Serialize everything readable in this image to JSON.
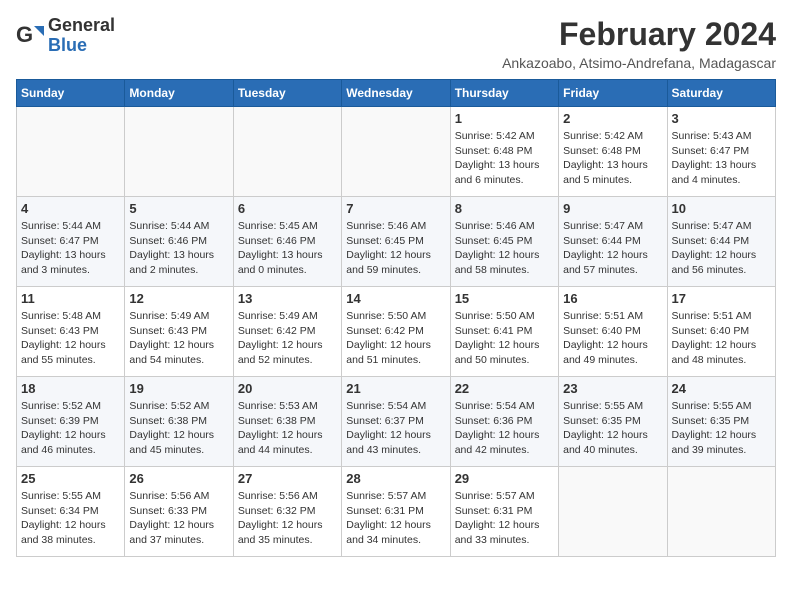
{
  "logo": {
    "general": "General",
    "blue": "Blue"
  },
  "title": {
    "month_year": "February 2024",
    "location": "Ankazoabo, Atsimo-Andrefana, Madagascar"
  },
  "weekdays": [
    "Sunday",
    "Monday",
    "Tuesday",
    "Wednesday",
    "Thursday",
    "Friday",
    "Saturday"
  ],
  "weeks": [
    [
      {
        "day": "",
        "info": ""
      },
      {
        "day": "",
        "info": ""
      },
      {
        "day": "",
        "info": ""
      },
      {
        "day": "",
        "info": ""
      },
      {
        "day": "1",
        "info": "Sunrise: 5:42 AM\nSunset: 6:48 PM\nDaylight: 13 hours and 6 minutes."
      },
      {
        "day": "2",
        "info": "Sunrise: 5:42 AM\nSunset: 6:48 PM\nDaylight: 13 hours and 5 minutes."
      },
      {
        "day": "3",
        "info": "Sunrise: 5:43 AM\nSunset: 6:47 PM\nDaylight: 13 hours and 4 minutes."
      }
    ],
    [
      {
        "day": "4",
        "info": "Sunrise: 5:44 AM\nSunset: 6:47 PM\nDaylight: 13 hours and 3 minutes."
      },
      {
        "day": "5",
        "info": "Sunrise: 5:44 AM\nSunset: 6:46 PM\nDaylight: 13 hours and 2 minutes."
      },
      {
        "day": "6",
        "info": "Sunrise: 5:45 AM\nSunset: 6:46 PM\nDaylight: 13 hours and 0 minutes."
      },
      {
        "day": "7",
        "info": "Sunrise: 5:46 AM\nSunset: 6:45 PM\nDaylight: 12 hours and 59 minutes."
      },
      {
        "day": "8",
        "info": "Sunrise: 5:46 AM\nSunset: 6:45 PM\nDaylight: 12 hours and 58 minutes."
      },
      {
        "day": "9",
        "info": "Sunrise: 5:47 AM\nSunset: 6:44 PM\nDaylight: 12 hours and 57 minutes."
      },
      {
        "day": "10",
        "info": "Sunrise: 5:47 AM\nSunset: 6:44 PM\nDaylight: 12 hours and 56 minutes."
      }
    ],
    [
      {
        "day": "11",
        "info": "Sunrise: 5:48 AM\nSunset: 6:43 PM\nDaylight: 12 hours and 55 minutes."
      },
      {
        "day": "12",
        "info": "Sunrise: 5:49 AM\nSunset: 6:43 PM\nDaylight: 12 hours and 54 minutes."
      },
      {
        "day": "13",
        "info": "Sunrise: 5:49 AM\nSunset: 6:42 PM\nDaylight: 12 hours and 52 minutes."
      },
      {
        "day": "14",
        "info": "Sunrise: 5:50 AM\nSunset: 6:42 PM\nDaylight: 12 hours and 51 minutes."
      },
      {
        "day": "15",
        "info": "Sunrise: 5:50 AM\nSunset: 6:41 PM\nDaylight: 12 hours and 50 minutes."
      },
      {
        "day": "16",
        "info": "Sunrise: 5:51 AM\nSunset: 6:40 PM\nDaylight: 12 hours and 49 minutes."
      },
      {
        "day": "17",
        "info": "Sunrise: 5:51 AM\nSunset: 6:40 PM\nDaylight: 12 hours and 48 minutes."
      }
    ],
    [
      {
        "day": "18",
        "info": "Sunrise: 5:52 AM\nSunset: 6:39 PM\nDaylight: 12 hours and 46 minutes."
      },
      {
        "day": "19",
        "info": "Sunrise: 5:52 AM\nSunset: 6:38 PM\nDaylight: 12 hours and 45 minutes."
      },
      {
        "day": "20",
        "info": "Sunrise: 5:53 AM\nSunset: 6:38 PM\nDaylight: 12 hours and 44 minutes."
      },
      {
        "day": "21",
        "info": "Sunrise: 5:54 AM\nSunset: 6:37 PM\nDaylight: 12 hours and 43 minutes."
      },
      {
        "day": "22",
        "info": "Sunrise: 5:54 AM\nSunset: 6:36 PM\nDaylight: 12 hours and 42 minutes."
      },
      {
        "day": "23",
        "info": "Sunrise: 5:55 AM\nSunset: 6:35 PM\nDaylight: 12 hours and 40 minutes."
      },
      {
        "day": "24",
        "info": "Sunrise: 5:55 AM\nSunset: 6:35 PM\nDaylight: 12 hours and 39 minutes."
      }
    ],
    [
      {
        "day": "25",
        "info": "Sunrise: 5:55 AM\nSunset: 6:34 PM\nDaylight: 12 hours and 38 minutes."
      },
      {
        "day": "26",
        "info": "Sunrise: 5:56 AM\nSunset: 6:33 PM\nDaylight: 12 hours and 37 minutes."
      },
      {
        "day": "27",
        "info": "Sunrise: 5:56 AM\nSunset: 6:32 PM\nDaylight: 12 hours and 35 minutes."
      },
      {
        "day": "28",
        "info": "Sunrise: 5:57 AM\nSunset: 6:31 PM\nDaylight: 12 hours and 34 minutes."
      },
      {
        "day": "29",
        "info": "Sunrise: 5:57 AM\nSunset: 6:31 PM\nDaylight: 12 hours and 33 minutes."
      },
      {
        "day": "",
        "info": ""
      },
      {
        "day": "",
        "info": ""
      }
    ]
  ]
}
